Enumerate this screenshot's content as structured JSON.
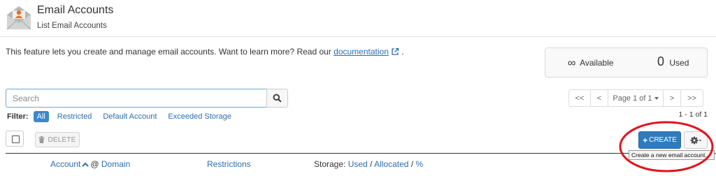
{
  "header": {
    "title": "Email Accounts",
    "subtitle": "List Email Accounts"
  },
  "intro": {
    "text": "This feature lets you create and manage email accounts. Want to learn more? Read our",
    "link_label": "documentation",
    "suffix": "."
  },
  "stats": {
    "available_symbol": "∞",
    "available_label": "Available",
    "used_count": "0",
    "used_label": "Used"
  },
  "search": {
    "placeholder": "Search",
    "value": ""
  },
  "filter": {
    "label": "Filter:",
    "options": [
      "All",
      "Restricted",
      "Default Account",
      "Exceeded Storage"
    ],
    "selected": "All"
  },
  "pagination": {
    "first": "<<",
    "prev": "<",
    "page_label": "Page 1 of 1",
    "next": ">",
    "last": ">>",
    "range": "1 - 1 of 1"
  },
  "toolbar": {
    "delete_label": "DELETE",
    "create_label": "CREATE",
    "tooltip": "Create a new email account."
  },
  "table": {
    "columns": {
      "account": "Account",
      "at": "@",
      "domain": "Domain",
      "restrictions": "Restrictions",
      "storage_prefix": "Storage:",
      "storage_used": "Used",
      "storage_allocated": "Allocated",
      "storage_percent": "%",
      "separator": "/"
    }
  },
  "colors": {
    "primary": "#2f7bbf",
    "link": "#2a6fb0",
    "highlight_circle": "#e0141e",
    "icon_accent": "#e8702a"
  }
}
